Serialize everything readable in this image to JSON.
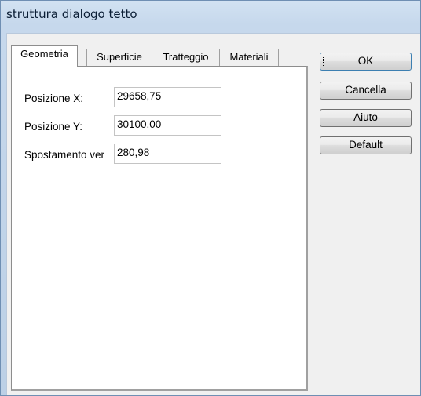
{
  "window": {
    "title": "struttura dialogo tetto"
  },
  "tabs": [
    {
      "label": "Geometria",
      "active": true
    },
    {
      "label": "Superficie",
      "active": false
    },
    {
      "label": "Tratteggio",
      "active": false
    },
    {
      "label": "Materiali",
      "active": false
    }
  ],
  "form": {
    "pos_x": {
      "label": "Posizione X:",
      "value": "29658,75"
    },
    "pos_y": {
      "label": "Posizione Y:",
      "value": "30100,00"
    },
    "spost": {
      "label": "Spostamento ver",
      "value": "280,98"
    }
  },
  "buttons": {
    "ok": "OK",
    "cancel": "Cancella",
    "help": "Aiuto",
    "default": "Default"
  }
}
